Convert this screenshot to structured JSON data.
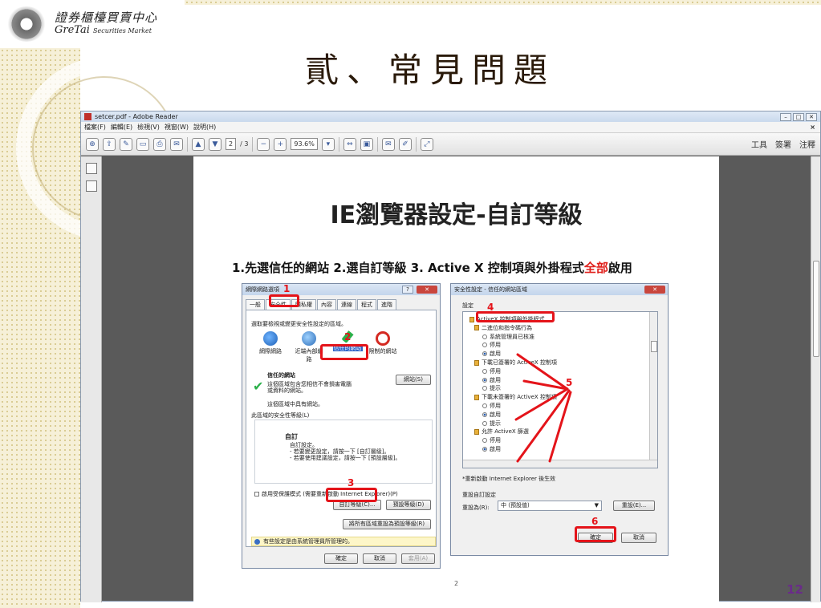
{
  "logo": {
    "cn": "證券櫃檯買賣中心",
    "en_main": "GreTai",
    "en_sub": "Securities Market"
  },
  "slide_title": "貳、常見問題",
  "slide_number": "12",
  "reader": {
    "title": "setcer.pdf - Adobe Reader",
    "menu": [
      "檔案(F)",
      "編輯(E)",
      "檢視(V)",
      "視窗(W)",
      "說明(H)"
    ],
    "page_current": "2",
    "page_total": "/ 3",
    "zoom": "93.6%",
    "right_tools": [
      "工具",
      "簽署",
      "注釋"
    ]
  },
  "page": {
    "heading": "IE瀏覽器設定-自訂等級",
    "steps_pre": "1.先選信任的網站  2.選自訂等級  3. Active X 控制項與外掛程式",
    "steps_red": "全部",
    "steps_post": "啟用",
    "page_num": "2"
  },
  "left_dialog": {
    "title": "網際網路選項",
    "tabs": [
      "一般",
      "安全性",
      "隱私權",
      "內容",
      "連線",
      "程式",
      "進階"
    ],
    "prompt": "選取要檢視或變更安全性設定的區域。",
    "zones": [
      "網際網路",
      "近端內部網路",
      "信任的網站",
      "限制的網站"
    ],
    "zone_title": "信任的網站",
    "zone_desc": "這個區域包含您相信不會損害電腦或資料的網站。",
    "zone_note": "這個區域中具有網站。",
    "sites_button": "網站(S)",
    "level_label": "此區域的安全性等級(L)",
    "custom": "自訂",
    "custom_desc": "自訂設定。\n- 若要變更設定，請按一下 [自訂層級]。\n- 若要使用建議設定，請按一下 [預設層級]。",
    "protected_mode": "啟用受保護模式 (需要重新啟動 Internet Explorer)(P)",
    "custom_level_button": "自訂等級(C)...",
    "default_level_button": "預設等級(D)",
    "reset_all_button": "將所有區域重設為預設等級(R)",
    "info": "有些設定是由系統管理員所管理的。",
    "ok": "確定",
    "cancel": "取消",
    "apply": "套用(A)"
  },
  "right_dialog": {
    "title": "安全性設定 - 信任的網站區域",
    "settings_label": "設定",
    "items": [
      {
        "kind": "group",
        "text": "ActiveX 控制項與外掛程式"
      },
      {
        "kind": "item",
        "text": "二進位和指令碼行為"
      },
      {
        "kind": "radio",
        "text": "系統管理員已核准",
        "on": false
      },
      {
        "kind": "radio",
        "text": "停用",
        "on": false
      },
      {
        "kind": "radio",
        "text": "啟用",
        "on": true
      },
      {
        "kind": "item",
        "text": "下載已簽署的 ActiveX 控制項"
      },
      {
        "kind": "radio",
        "text": "停用",
        "on": false
      },
      {
        "kind": "radio",
        "text": "啟用",
        "on": true
      },
      {
        "kind": "radio",
        "text": "提示",
        "on": false
      },
      {
        "kind": "item",
        "text": "下載未簽署的 ActiveX 控制項"
      },
      {
        "kind": "radio",
        "text": "停用",
        "on": false
      },
      {
        "kind": "radio",
        "text": "啟用",
        "on": true
      },
      {
        "kind": "radio",
        "text": "提示",
        "on": false
      },
      {
        "kind": "item",
        "text": "允許 ActiveX 篩選"
      },
      {
        "kind": "radio",
        "text": "停用",
        "on": false
      },
      {
        "kind": "radio",
        "text": "啟用",
        "on": true
      }
    ],
    "restart_note": "*重新啟動 Internet Explorer 後生效",
    "reset_label": "重設自訂設定",
    "reset_to": "重設為(R):",
    "reset_value": "中 (預設值)",
    "reset_button": "重設(E)...",
    "ok": "確定",
    "cancel": "取消"
  },
  "markers": [
    "1",
    "2",
    "3",
    "4",
    "5",
    "6"
  ],
  "colors": {
    "accent_red": "#e4141a",
    "slide_number": "#6a2b8a"
  }
}
